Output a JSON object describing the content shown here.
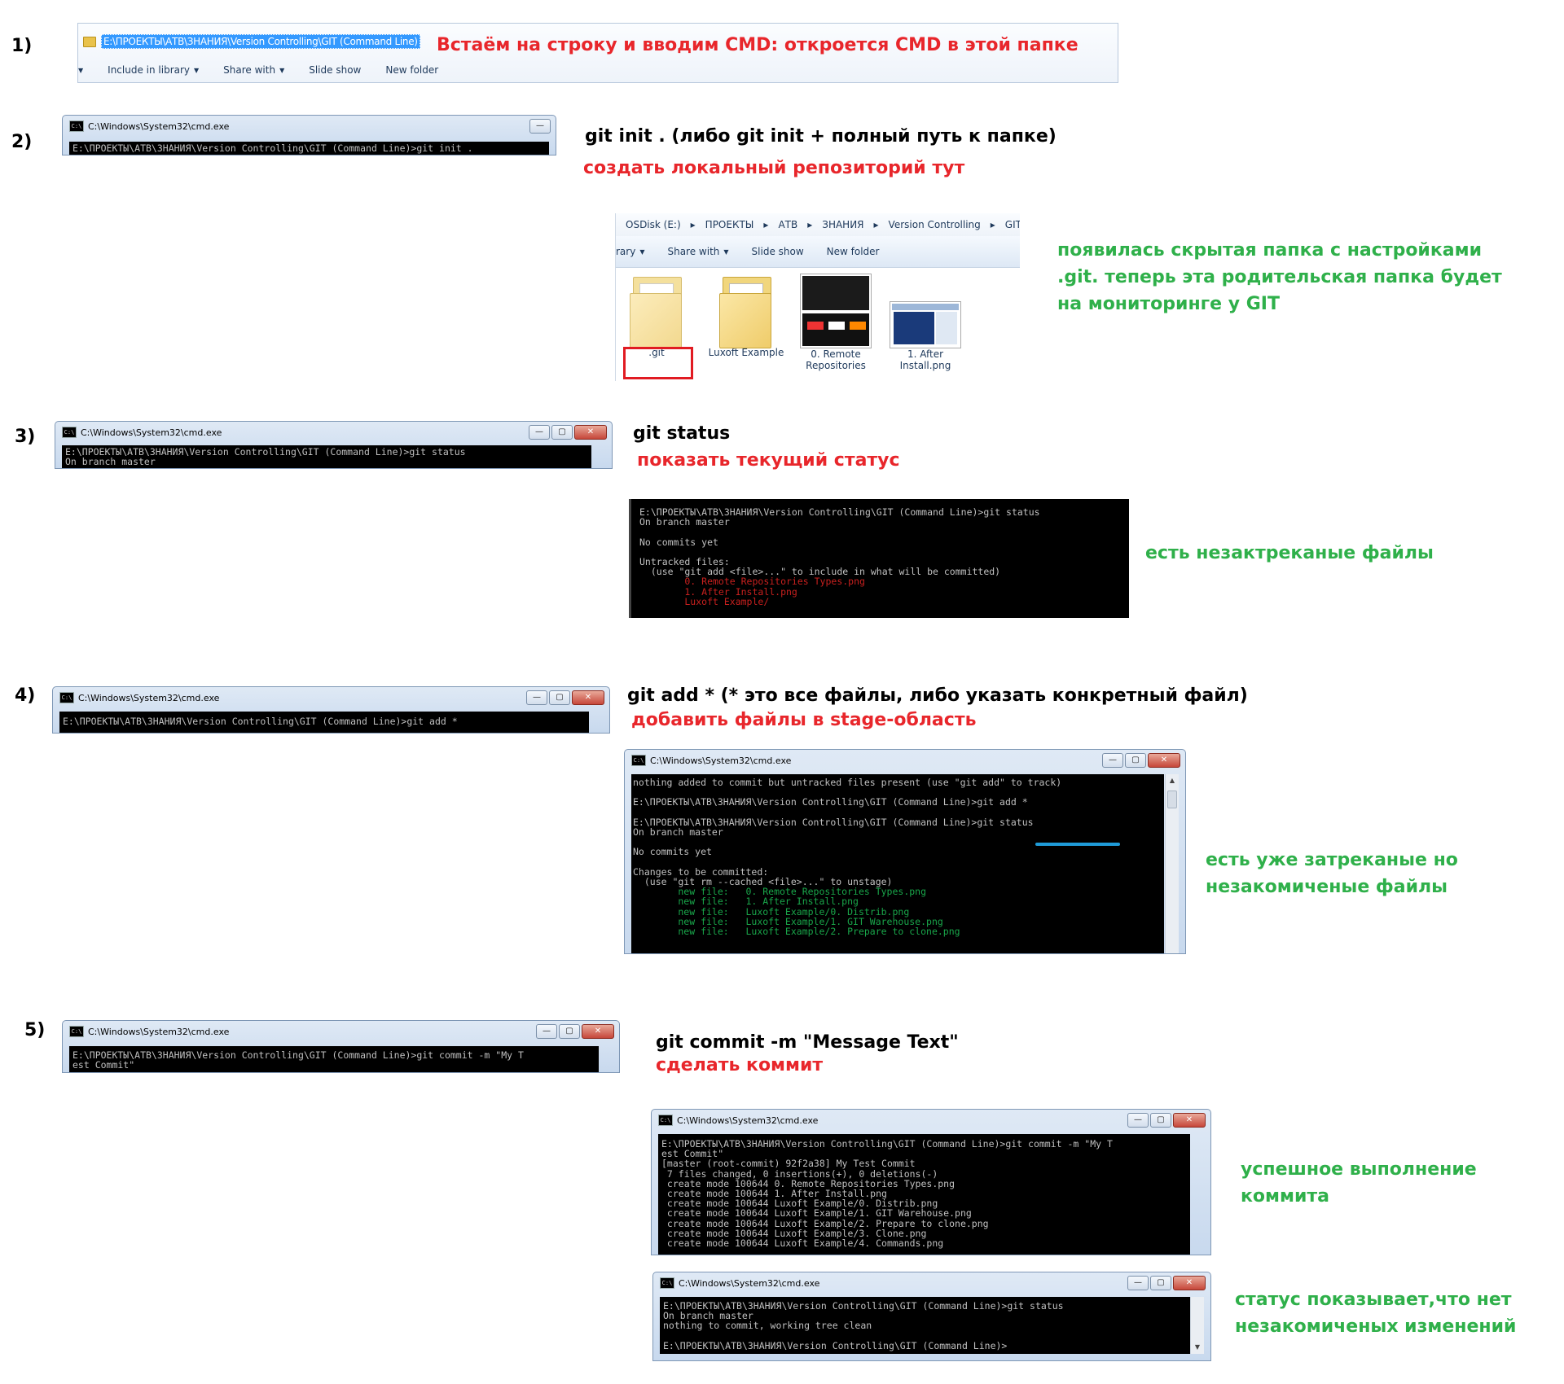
{
  "steps": {
    "s1": "1)",
    "s2": "2)",
    "s3": "3)",
    "s4": "4)",
    "s5": "5)"
  },
  "explorer_top": {
    "address": "E:\\ПРОЕКТЫ\\АТВ\\ЗНАНИЯ\\Version Controlling\\GIT (Command Line)",
    "note": "Встаём на строку и вводим CMD: откроется CMD в этой папке",
    "toolbar": [
      "Include in library",
      "Share with",
      "Slide show",
      "New folder"
    ]
  },
  "cmd_title": "C:\\Windows\\System32\\cmd.exe",
  "step2": {
    "cmd_line": "E:\\ПРОЕКТЫ\\АТВ\\ЗНАНИЯ\\Version Controlling\\GIT (Command Line)>git init .",
    "command": "git init . (либо git init + полный путь к папке)",
    "desc": "создать локальный репозиторий тут",
    "explorer": {
      "breadcrumb": [
        "OSDisk (E:)",
        "ПРОЕКТЫ",
        "АТВ",
        "ЗНАНИЯ",
        "Version Controlling",
        "GIT (Comman"
      ],
      "toolbar": [
        "rary",
        "Share with",
        "Slide show",
        "New folder"
      ],
      "files": [
        ".git",
        "Luxoft Example",
        "0. Remote Repositories",
        "1. After Install.png"
      ]
    },
    "note": "появилась скрытая папка с настройками .git. теперь эта родительская папка будет на мониторинге у GIT"
  },
  "step3": {
    "cmd_lines": "E:\\ПРОЕКТЫ\\АТВ\\ЗНАНИЯ\\Version Controlling\\GIT (Command Line)>git status\nOn branch master",
    "command": "git status",
    "desc": "показать текущий статус",
    "output_white": "E:\\ПРОЕКТЫ\\АТВ\\ЗНАНИЯ\\Version Controlling\\GIT (Command Line)>git status\nOn branch master\n\nNo commits yet\n\nUntracked files:\n  (use \"git add <file>...\" to include in what will be committed)\n",
    "output_red": "        0. Remote Repositories Types.png\n        1. After Install.png\n        Luxoft Example/",
    "note": "есть незактреканые файлы"
  },
  "step4": {
    "cmd_line": "E:\\ПРОЕКТЫ\\АТВ\\ЗНАНИЯ\\Version Controlling\\GIT (Command Line)>git add *",
    "command": "git add * (* это все файлы, либо указать конкретный файл)",
    "desc": "добавить файлы в stage-область",
    "output_white": "nothing added to commit but untracked files present (use \"git add\" to track)\n\nE:\\ПРОЕКТЫ\\АТВ\\ЗНАНИЯ\\Version Controlling\\GIT (Command Line)>git add *\n\nE:\\ПРОЕКТЫ\\АТВ\\ЗНАНИЯ\\Version Controlling\\GIT (Command Line)>git status\nOn branch master\n\nNo commits yet\n\nChanges to be committed:\n  (use \"git rm --cached <file>...\" to unstage)\n",
    "output_green": "        new file:   0. Remote Repositories Types.png\n        new file:   1. After Install.png\n        new file:   Luxoft Example/0. Distrib.png\n        new file:   Luxoft Example/1. GIT Warehouse.png\n        new file:   Luxoft Example/2. Prepare to clone.png",
    "note": "есть уже затреканые но незакомиченые файлы"
  },
  "step5": {
    "cmd_lines": "E:\\ПРОЕКТЫ\\АТВ\\ЗНАНИЯ\\Version Controlling\\GIT (Command Line)>git commit -m \"My T\nest Commit\"",
    "command": "git commit -m \"Message Text\"",
    "desc": "сделать коммит",
    "output_commit": "E:\\ПРОЕКТЫ\\АТВ\\ЗНАНИЯ\\Version Controlling\\GIT (Command Line)>git commit -m \"My T\nest Commit\"\n[master (root-commit) 92f2a38] My Test Commit\n 7 files changed, 0 insertions(+), 0 deletions(-)\n create mode 100644 0. Remote Repositories Types.png\n create mode 100644 1. After Install.png\n create mode 100644 Luxoft Example/0. Distrib.png\n create mode 100644 Luxoft Example/1. GIT Warehouse.png\n create mode 100644 Luxoft Example/2. Prepare to clone.png\n create mode 100644 Luxoft Example/3. Clone.png\n create mode 100644 Luxoft Example/4. Commands.png",
    "note_commit": "успешное выполнение коммита",
    "output_status": "E:\\ПРОЕКТЫ\\АТВ\\ЗНАНИЯ\\Version Controlling\\GIT (Command Line)>git status\nOn branch master\nnothing to commit, working tree clean\n\nE:\\ПРОЕКТЫ\\АТВ\\ЗНАНИЯ\\Version Controlling\\GIT (Command Line)>",
    "note_status": "статус показывает,что нет незакомиченых изменений"
  }
}
